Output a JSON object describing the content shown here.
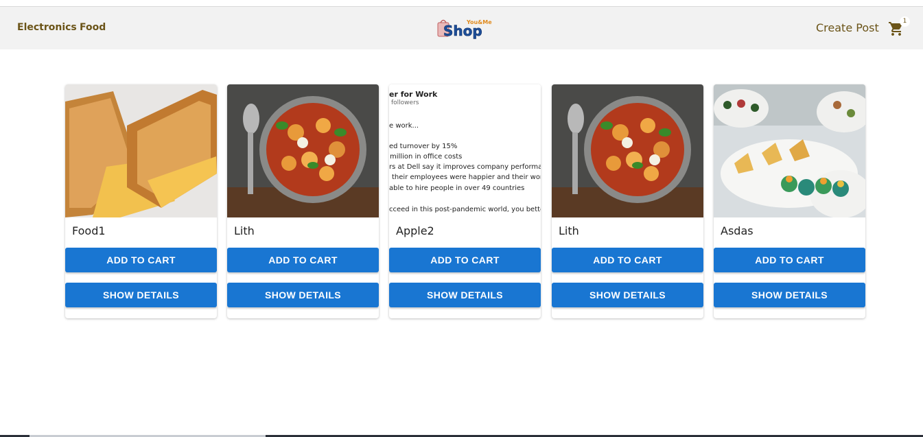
{
  "nav": {
    "links": [
      "Electronics",
      "Food"
    ],
    "logo_small": "You&Me",
    "logo_main": "Shop",
    "create_post": "Create Post",
    "cart_count": "1"
  },
  "colors": {
    "brand": "#6b5418",
    "button": "#1976d2",
    "navbar": "#f2f2f2"
  },
  "products": [
    {
      "title": "Food1",
      "image": "grilled-cheese-photo",
      "add_label": "ADD TO CART",
      "details_label": "SHOW DETAILS"
    },
    {
      "title": "Lith",
      "image": "gnocchi-pan-photo",
      "add_label": "ADD TO CART",
      "details_label": "SHOW DETAILS"
    },
    {
      "title": "Apple2",
      "image": "document-screenshot",
      "add_label": "ADD TO CART",
      "details_label": "SHOW DETAILS"
    },
    {
      "title": "Lith",
      "image": "gnocchi-pan-photo",
      "add_label": "ADD TO CART",
      "details_label": "SHOW DETAILS"
    },
    {
      "title": "Asdas",
      "image": "appetizers-photo",
      "add_label": "ADD TO CART",
      "details_label": "SHOW DETAILS"
    }
  ],
  "doc_image": {
    "heading": "er for Work",
    "followers": "followers",
    "lines": [
      "e work...",
      "ed turnover by 15%",
      "million in office costs",
      "rs at Dell say it improves company performanc",
      "their employees were happier and their work r",
      "able to hire people in over 49 countries",
      "cceed in this post-pandemic world, you better g"
    ]
  }
}
